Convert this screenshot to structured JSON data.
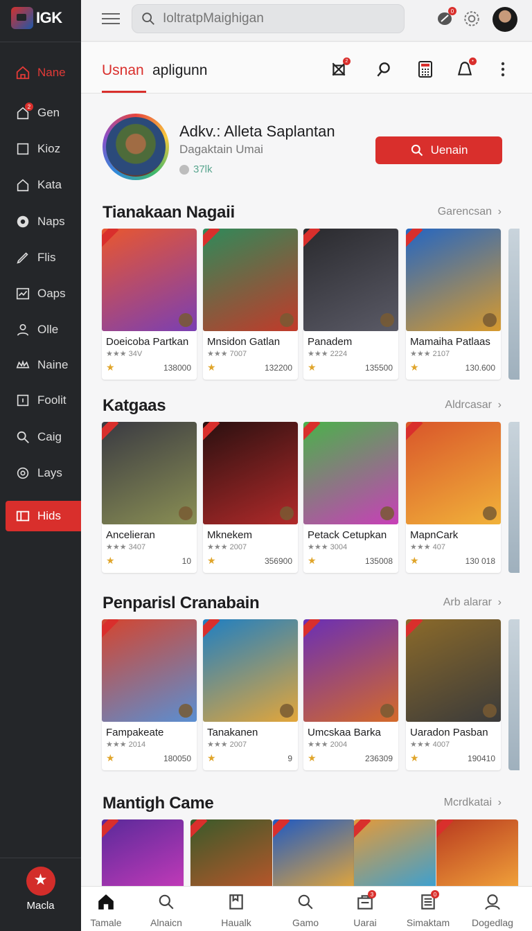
{
  "app": {
    "logo_text": "IGK",
    "avatar_alt": "user avatar"
  },
  "search": {
    "placeholder": "IoltratpMaighigan",
    "value": ""
  },
  "topbar": {
    "notif_badge": "0"
  },
  "sidebar": {
    "items": [
      {
        "label": "Nane",
        "icon": "home-icon",
        "active": true
      },
      {
        "label": "Gen",
        "icon": "house-badge-icon",
        "badge": "2"
      },
      {
        "label": "Kioz",
        "icon": "square-icon"
      },
      {
        "label": "Kata",
        "icon": "house-icon"
      },
      {
        "label": "Naps",
        "icon": "gear-icon"
      },
      {
        "label": "Flis",
        "icon": "pen-icon"
      },
      {
        "label": "Oaps",
        "icon": "chart-icon"
      },
      {
        "label": "Olle",
        "icon": "user-icon"
      },
      {
        "label": "Naine",
        "icon": "crown-icon"
      },
      {
        "label": "Foolit",
        "icon": "frame-icon"
      },
      {
        "label": "Caig",
        "icon": "search-icon"
      },
      {
        "label": "Lays",
        "icon": "gear-icon"
      },
      {
        "label": "Hids",
        "icon": "cards-icon",
        "highlight": true
      }
    ],
    "bottom_label": "Macla"
  },
  "tabs": [
    {
      "label": "Usnan",
      "active": true
    },
    {
      "label": "apligunn",
      "active": false
    }
  ],
  "tab_actions": [
    {
      "icon": "controller-icon",
      "badge": "2"
    },
    {
      "icon": "search-icon"
    },
    {
      "icon": "calculator-icon"
    },
    {
      "icon": "bell-icon",
      "badge": "•"
    },
    {
      "icon": "more-icon"
    }
  ],
  "featured": {
    "title": "Adkv.: Alleta Saplantan",
    "subtitle": "Dagaktain Umai",
    "count": "37lk",
    "button_label": "Uenain"
  },
  "sections": [
    {
      "title": "Tianakaan Nagaii",
      "more": "Garencsan",
      "cards": [
        {
          "name": "Doeicoba Partkan",
          "meta": "★★★ 34V",
          "downloads": "138000",
          "colors": [
            "#e9572f",
            "#7a3fb3"
          ]
        },
        {
          "name": "Mnsidon Gatlan",
          "meta": "★★★ 7007",
          "downloads": "132200",
          "colors": [
            "#2f8a5a",
            "#c23a2a"
          ]
        },
        {
          "name": "Panadem",
          "meta": "★★★ 2224",
          "downloads": "135500",
          "colors": [
            "#2a2a2e",
            "#5a5a66"
          ]
        },
        {
          "name": "Mamaiha Patlaas",
          "meta": "★★★ 2107",
          "downloads": "130.600",
          "colors": [
            "#2466c2",
            "#d79a2e"
          ]
        }
      ]
    },
    {
      "title": "Katgaas",
      "more": "Aldrcasar",
      "cards": [
        {
          "name": "Ancelieran",
          "meta": "★★★ 3407",
          "downloads": "10",
          "colors": [
            "#3a3a42",
            "#8a8f54"
          ]
        },
        {
          "name": "Mknekem",
          "meta": "★★★ 2007",
          "downloads": "356900",
          "colors": [
            "#2a1010",
            "#b12a2a"
          ]
        },
        {
          "name": "Petack Cetupkan",
          "meta": "★★★ 3004",
          "downloads": "135008",
          "colors": [
            "#4ab24a",
            "#c83fb8"
          ]
        },
        {
          "name": "MapnCark",
          "meta": "★★★ 407",
          "downloads": "130 018",
          "colors": [
            "#d9562a",
            "#f1b23a"
          ]
        }
      ]
    },
    {
      "title": "Penparisl Cranabain",
      "more": "Arb alarar",
      "cards": [
        {
          "name": "Fampakeate",
          "meta": "★★★ 2014",
          "downloads": "180050",
          "colors": [
            "#d4452f",
            "#5a8fd2"
          ]
        },
        {
          "name": "Tanakanen",
          "meta": "★★★ 2007",
          "downloads": "9",
          "colors": [
            "#1f7fc2",
            "#e3a63a"
          ]
        },
        {
          "name": "Umcskaa Barka",
          "meta": "★★★ 2004",
          "downloads": "236309",
          "colors": [
            "#6a2fb5",
            "#d46a2a"
          ]
        },
        {
          "name": "Uaradon Pasban",
          "meta": "★★★ 4007",
          "downloads": "190410",
          "colors": [
            "#8b6a2a",
            "#3a3a3a"
          ]
        }
      ]
    },
    {
      "title": "Mantigh Came",
      "more": "Mcrdkatai",
      "cards": [
        {
          "colors": [
            "#5a2a9a",
            "#c23ab8"
          ]
        },
        {
          "colors": [
            "#3a5a2a",
            "#b8562a"
          ]
        },
        {
          "colors": [
            "#1f5ac2",
            "#e3a63a"
          ]
        },
        {
          "colors": [
            "#e39a3a",
            "#3aa0d2"
          ]
        },
        {
          "colors": [
            "#b83a1f",
            "#f1a23a"
          ]
        }
      ]
    }
  ],
  "bottom_nav": [
    {
      "label": "Tamale",
      "icon": "home-icon",
      "active": true
    },
    {
      "label": "Alnaicn",
      "icon": "search-icon"
    },
    {
      "label": "Haualk",
      "icon": "bookmark-icon"
    },
    {
      "label": "Gamo",
      "icon": "search-icon"
    },
    {
      "label": "Uarai",
      "icon": "bag-icon",
      "badge": "3"
    },
    {
      "label": "Simaktam",
      "icon": "list-icon",
      "badge": "0"
    },
    {
      "label": "Dogedlag",
      "icon": "user-icon"
    }
  ]
}
